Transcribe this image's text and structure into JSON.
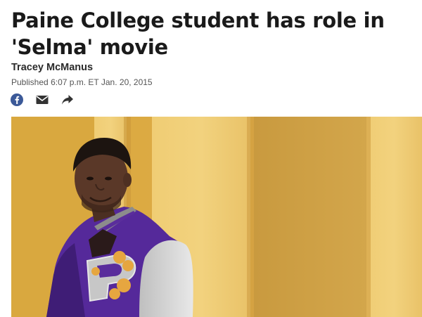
{
  "article": {
    "headline": "Paine College student has role in 'Selma' movie",
    "author": "Tracey McManus",
    "published_label": "Published",
    "published_time": "6:07 p.m. ET Jan. 20, 2015"
  },
  "share": {
    "icons": [
      "facebook-icon",
      "email-icon",
      "share-arrow-icon"
    ]
  },
  "colors": {
    "facebook_blue": "#3b5998",
    "icon_gray": "#333333",
    "wall_yellow": "#e3b44a",
    "jacket_purple": "#5a2d9c"
  }
}
